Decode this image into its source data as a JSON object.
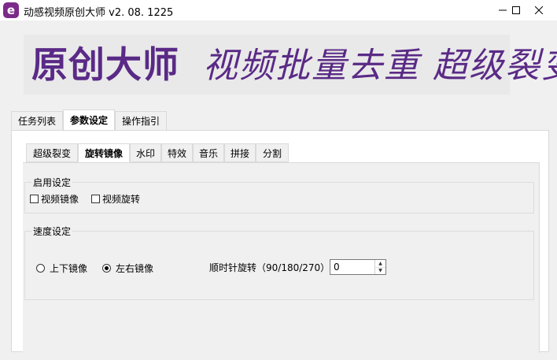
{
  "window": {
    "title": "动感视频原创大师  v2. 08. 1225",
    "icon_letter": "e",
    "icon_color": "#7b2a8a"
  },
  "banner": {
    "title": "原创大师",
    "slogan": "视频批量去重  超级裂变",
    "color": "#5a2a86"
  },
  "outer_tabs": [
    "任务列表",
    "参数设定",
    "操作指引"
  ],
  "inner_tabs": [
    "超级裂变",
    "旋转镜像",
    "水印",
    "特效",
    "音乐",
    "拼接",
    "分割"
  ],
  "enable_group": {
    "label": "启用设定",
    "options": [
      {
        "label": "视频镜像",
        "checked": false
      },
      {
        "label": "视频旋转",
        "checked": false
      }
    ]
  },
  "speed_group": {
    "label": "速度设定",
    "radios": [
      {
        "label": "上下镜像",
        "selected": false
      },
      {
        "label": "左右镜像",
        "selected": true
      }
    ],
    "rotation_label": "顺时针旋转（90/180/270）",
    "rotation_value": "0"
  }
}
